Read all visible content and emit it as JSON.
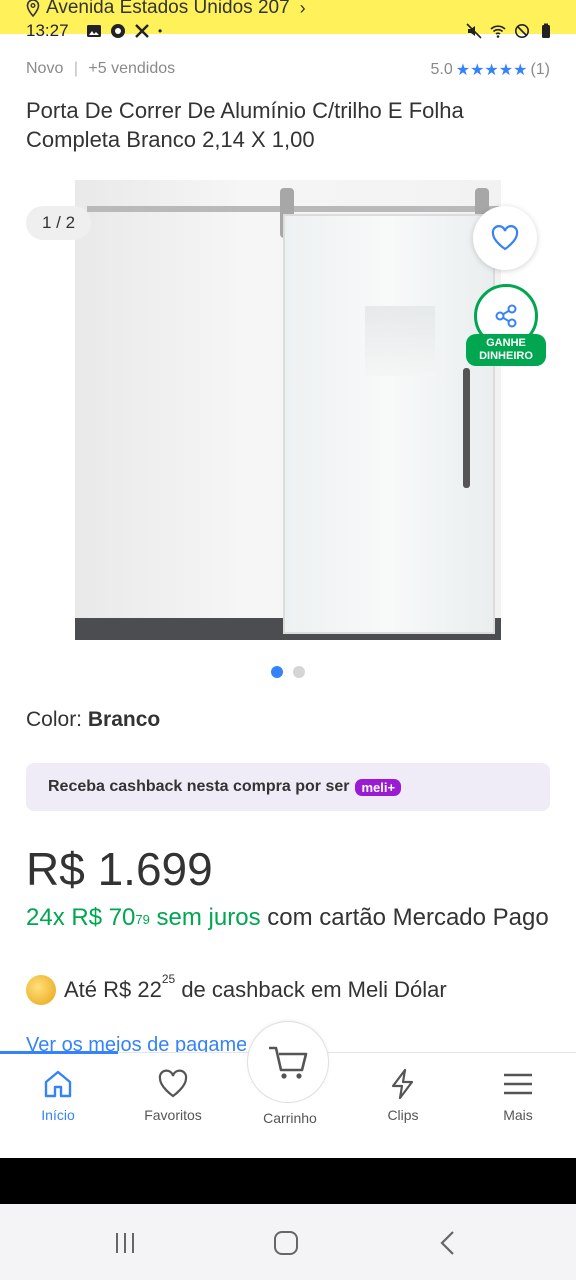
{
  "header": {
    "address": "Avenida Estados Unidos 207",
    "time": "13:27"
  },
  "product": {
    "condition": "Novo",
    "sold": "+5 vendidos",
    "rating": "5.0",
    "stars": "★★★★★",
    "reviews": "(1)",
    "title": "Porta De Correr De Alumínio C/trilho E Folha Completa  Branco 2,14 X 1,00"
  },
  "gallery": {
    "counter": "1 / 2",
    "share_badge_line1": "GANHE",
    "share_badge_line2": "DINHEIRO",
    "current_image": 1,
    "total_images": 2
  },
  "color": {
    "label": "Color: ",
    "value": "Branco"
  },
  "cashback_banner": {
    "text": "Receba cashback nesta compra por ser",
    "badge": "meli+"
  },
  "price": {
    "main": "R$ 1.699",
    "installments_green": "24x R$ 70",
    "installments_cents": "79",
    "installments_green2": " sem juros",
    "installments_rest": " com cartão Mercado Pago",
    "cashback_prefix": "Até R$ 22",
    "cashback_cents": "25",
    "cashback_suffix": " de cashback em Meli Dólar",
    "payment_link": "Ver os meios de pagamento"
  },
  "nav": {
    "home": "Início",
    "favorites": "Favoritos",
    "cart": "Carrinho",
    "clips": "Clips",
    "more": "Mais"
  },
  "colors": {
    "accent": "#3483fa",
    "green": "#00a650",
    "header_yellow": "#fff159",
    "meli_purple": "#9b1ad4"
  }
}
